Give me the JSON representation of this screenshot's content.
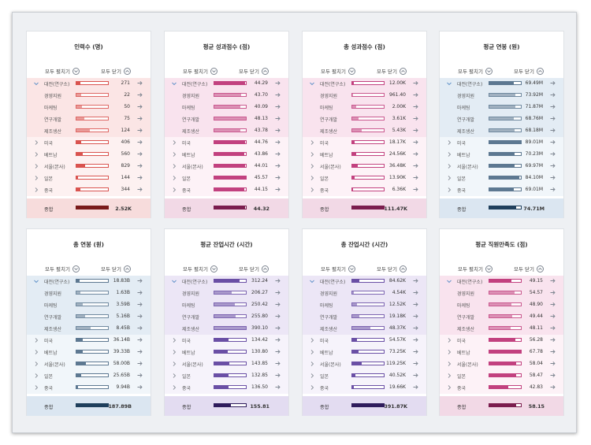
{
  "controls": {
    "expand_all": "모두 펼치기",
    "collapse_all": "모두 닫기"
  },
  "total_label": "종합",
  "row_labels": [
    "대전(연구소)",
    "경영지원",
    "마케팅",
    "연구개발",
    "제조생산",
    "미국",
    "베트남",
    "서울(본사)",
    "일본",
    "중국"
  ],
  "cards": [
    {
      "title": "인력수 (명)",
      "theme": "red",
      "bar": "#d9534f",
      "row_bg": "#fbe5e5",
      "tint": "#fdf1f1",
      "total_bg": "#f7dcdc",
      "total_bar": "#7a1a1a",
      "values": [
        "271",
        "22",
        "50",
        "75",
        "124",
        "406",
        "560",
        "829",
        "144",
        "344"
      ],
      "fills": [
        0.12,
        0.14,
        0.17,
        0.25,
        0.42,
        0.14,
        0.19,
        0.28,
        0.05,
        0.12
      ],
      "total": "2.52K",
      "total_fill": 1.0
    },
    {
      "title": "평균 성과점수 (점)",
      "theme": "pink",
      "bar": "#c2417f",
      "row_bg": "#f9e3ee",
      "tint": "#fdf2f7",
      "total_bg": "#f2d9e6",
      "total_bar": "#7b1d4e",
      "values": [
        "44.29",
        "43.70",
        "40.09",
        "48.13",
        "43.78",
        "44.76",
        "43.86",
        "44.01",
        "45.57",
        "44.15"
      ],
      "fills": [
        0.97,
        0.85,
        0.82,
        0.99,
        0.82,
        0.97,
        0.96,
        0.97,
        0.99,
        0.96
      ],
      "total": "44.32",
      "total_fill": 0.97
    },
    {
      "title": "총 성과점수 (점)",
      "theme": "pink",
      "bar": "#c2417f",
      "row_bg": "#f9e3ee",
      "tint": "#fdf2f7",
      "total_bg": "#f2d9e6",
      "total_bar": "#7b1d4e",
      "values": [
        "12.00K",
        "961.40",
        "2.00K",
        "3.61K",
        "5.43K",
        "18.17K",
        "24.56K",
        "36.48K",
        "13.90K",
        "6.36K"
      ],
      "fills": [
        0.06,
        0.02,
        0.12,
        0.2,
        0.3,
        0.08,
        0.12,
        0.18,
        0.07,
        0.03
      ],
      "total": "111.47K",
      "total_fill": 1.0
    },
    {
      "title": "평균 연봉 (원)",
      "theme": "blue",
      "bar": "#5d7891",
      "row_bg": "#e3ecf4",
      "tint": "#f1f6fa",
      "total_bg": "#dbe6f1",
      "total_bar": "#1f3f5c",
      "values": [
        "69.49M",
        "73.92M",
        "71.87M",
        "68.76M",
        "68.18M",
        "89.01M",
        "70.23M",
        "69.97M",
        "84.10M",
        "69.01M"
      ],
      "fills": [
        0.78,
        0.83,
        0.82,
        0.78,
        0.79,
        1.0,
        0.79,
        0.79,
        0.94,
        0.78
      ],
      "total": "74.71M",
      "total_fill": 0.84
    },
    {
      "title": "총 연봉 (원)",
      "theme": "blue",
      "bar": "#5d7891",
      "row_bg": "#e3ecf4",
      "tint": "#f1f6fa",
      "total_bg": "#dbe6f1",
      "total_bar": "#1f3f5c",
      "values": [
        "18.83B",
        "1.63B",
        "3.59B",
        "5.16B",
        "8.45B",
        "36.14B",
        "39.33B",
        "58.00B",
        "25.65B",
        "9.94B"
      ],
      "fills": [
        0.1,
        0.12,
        0.2,
        0.28,
        0.45,
        0.19,
        0.21,
        0.31,
        0.14,
        0.05
      ],
      "total": "187.89B",
      "total_fill": 1.0
    },
    {
      "title": "평균 잔업시간 (시간)",
      "theme": "purple",
      "bar": "#6a4fa5",
      "row_bg": "#ece6f6",
      "tint": "#f6f3fb",
      "total_bg": "#e3dcf1",
      "total_bar": "#2f1c5c",
      "values": [
        "312.24",
        "206.27",
        "250.42",
        "255.80",
        "390.10",
        "134.42",
        "130.80",
        "143.85",
        "132.85",
        "136.50"
      ],
      "fills": [
        0.8,
        0.55,
        0.66,
        0.67,
        1.0,
        0.45,
        0.43,
        0.48,
        0.44,
        0.45
      ],
      "total": "155.81",
      "total_fill": 0.52
    },
    {
      "title": "총 잔업시간 (시간)",
      "theme": "purple",
      "bar": "#6a4fa5",
      "row_bg": "#ece6f6",
      "tint": "#f6f3fb",
      "total_bg": "#e3dcf1",
      "total_bar": "#2f1c5c",
      "values": [
        "84.62K",
        "4.54K",
        "12.52K",
        "19.18K",
        "48.37K",
        "54.57K",
        "73.25K",
        "119.25K",
        "40.52K",
        "19.66K"
      ],
      "fills": [
        0.22,
        0.05,
        0.15,
        0.23,
        0.57,
        0.14,
        0.19,
        0.31,
        0.11,
        0.05
      ],
      "total": "391.87K",
      "total_fill": 1.0
    },
    {
      "title": "평균 직원만족도 (점)",
      "theme": "pink",
      "bar": "#c2417f",
      "row_bg": "#f9e3ee",
      "tint": "#fdf2f7",
      "total_bg": "#f2d9e6",
      "total_bar": "#7b1d4e",
      "values": [
        "49.15",
        "54.57",
        "48.90",
        "49.44",
        "48.11",
        "56.28",
        "67.78",
        "58.04",
        "58.47",
        "42.83"
      ],
      "fills": [
        0.7,
        0.8,
        0.7,
        0.72,
        0.68,
        0.82,
        1.0,
        0.85,
        0.86,
        0.6
      ],
      "total": "58.15",
      "total_fill": 0.85
    }
  ]
}
